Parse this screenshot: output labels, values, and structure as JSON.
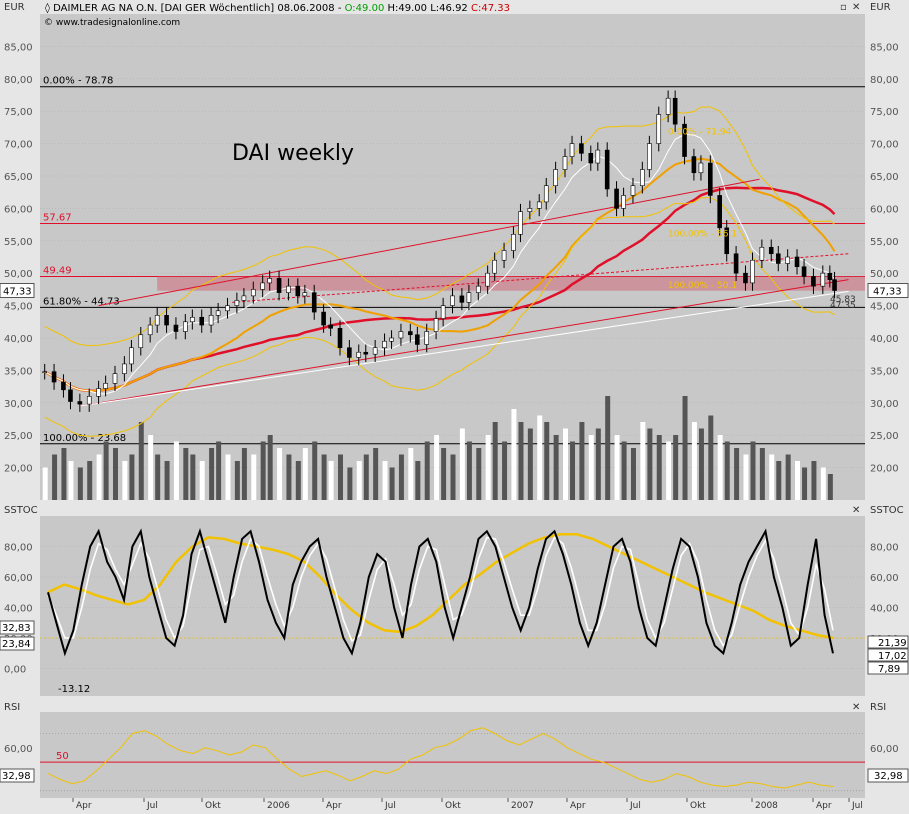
{
  "window": {
    "title": "DAIMLER AG NA O.N. [DAI GER  Wöchentlich] 08.06.2008 - ",
    "ohlc": {
      "o": "O:49.00",
      "h": "H:49.00",
      "l": "L:46.92",
      "c": "C:47.33"
    },
    "source": "www.tradesignalonline.com",
    "annotation": "DAI weekly",
    "colors": {
      "bg": "#c8c8c8",
      "gain": "#00a000",
      "loss": "#cc0000",
      "accent_red": "#e0102a",
      "accent_yellow": "#f2c200",
      "orange": "#f0a000"
    }
  },
  "chart_data": [
    {
      "panel": "price",
      "type": "candlestick",
      "unit_label": "EUR",
      "ylim": [
        15,
        90
      ],
      "y_ticks": [
        "85,00",
        "80,00",
        "75,00",
        "70,00",
        "65,00",
        "60,00",
        "55,00",
        "50,00",
        "45,00",
        "40,00",
        "35,00",
        "30,00",
        "25,00",
        "20,00"
      ],
      "x_ticks": [
        "Apr",
        "Jul",
        "Okt",
        "2006",
        "Apr",
        "Jul",
        "Okt",
        "2007",
        "Apr",
        "Jul",
        "Okt",
        "2008",
        "Apr",
        "Jul"
      ],
      "x_range": [
        2005.08,
        2008.6
      ],
      "last_price_tag": "47,33",
      "price_closes": [
        [
          2005.1,
          34.8
        ],
        [
          2005.14,
          33.2
        ],
        [
          2005.18,
          32.0
        ],
        [
          2005.21,
          30.2
        ],
        [
          2005.25,
          29.8
        ],
        [
          2005.29,
          31.0
        ],
        [
          2005.33,
          32.2
        ],
        [
          2005.36,
          33.0
        ],
        [
          2005.4,
          34.5
        ],
        [
          2005.44,
          36.0
        ],
        [
          2005.47,
          38.5
        ],
        [
          2005.51,
          40.5
        ],
        [
          2005.55,
          42.0
        ],
        [
          2005.58,
          43.5
        ],
        [
          2005.62,
          42.0
        ],
        [
          2005.66,
          41.0
        ],
        [
          2005.7,
          42.5
        ],
        [
          2005.73,
          43.2
        ],
        [
          2005.77,
          42.0
        ],
        [
          2005.81,
          43.5
        ],
        [
          2005.84,
          44.2
        ],
        [
          2005.88,
          45.0
        ],
        [
          2005.92,
          45.8
        ],
        [
          2005.95,
          46.5
        ],
        [
          2005.99,
          47.5
        ],
        [
          2006.03,
          48.5
        ],
        [
          2006.06,
          49.2
        ],
        [
          2006.1,
          47.0
        ],
        [
          2006.14,
          48.0
        ],
        [
          2006.18,
          46.5
        ],
        [
          2006.21,
          47.0
        ],
        [
          2006.25,
          44.0
        ],
        [
          2006.29,
          42.0
        ],
        [
          2006.32,
          41.5
        ],
        [
          2006.36,
          38.5
        ],
        [
          2006.4,
          37.0
        ],
        [
          2006.44,
          37.8
        ],
        [
          2006.47,
          37.5
        ],
        [
          2006.51,
          38.5
        ],
        [
          2006.55,
          39.5
        ],
        [
          2006.58,
          40.0
        ],
        [
          2006.62,
          41.0
        ],
        [
          2006.66,
          40.5
        ],
        [
          2006.69,
          39.0
        ],
        [
          2006.73,
          41.0
        ],
        [
          2006.77,
          43.0
        ],
        [
          2006.8,
          45.0
        ],
        [
          2006.84,
          46.5
        ],
        [
          2006.88,
          45.5
        ],
        [
          2006.91,
          47.0
        ],
        [
          2006.95,
          48.0
        ],
        [
          2006.99,
          50.0
        ],
        [
          2007.02,
          52.0
        ],
        [
          2007.06,
          53.5
        ],
        [
          2007.1,
          56.0
        ],
        [
          2007.13,
          59.5
        ],
        [
          2007.17,
          60.0
        ],
        [
          2007.21,
          61.0
        ],
        [
          2007.24,
          63.5
        ],
        [
          2007.28,
          66.0
        ],
        [
          2007.32,
          68.0
        ],
        [
          2007.35,
          70.0
        ],
        [
          2007.39,
          68.5
        ],
        [
          2007.43,
          67.0
        ],
        [
          2007.46,
          69.0
        ],
        [
          2007.5,
          63.0
        ],
        [
          2007.54,
          60.0
        ],
        [
          2007.57,
          62.0
        ],
        [
          2007.61,
          63.5
        ],
        [
          2007.65,
          66.0
        ],
        [
          2007.68,
          70.0
        ],
        [
          2007.72,
          74.5
        ],
        [
          2007.76,
          77.0
        ],
        [
          2007.79,
          73.0
        ],
        [
          2007.83,
          68.0
        ],
        [
          2007.87,
          65.5
        ],
        [
          2007.9,
          67.0
        ],
        [
          2007.94,
          62.0
        ],
        [
          2007.98,
          57.0
        ],
        [
          2008.01,
          53.0
        ],
        [
          2008.05,
          50.0
        ],
        [
          2008.09,
          48.5
        ],
        [
          2008.12,
          52.0
        ],
        [
          2008.16,
          54.0
        ],
        [
          2008.2,
          53.0
        ],
        [
          2008.23,
          51.5
        ],
        [
          2008.27,
          52.5
        ],
        [
          2008.31,
          51.0
        ],
        [
          2008.34,
          49.5
        ],
        [
          2008.38,
          48.0
        ],
        [
          2008.42,
          50.0
        ],
        [
          2008.45,
          49.0
        ],
        [
          2008.47,
          47.33
        ]
      ],
      "volume": [
        5,
        7,
        8,
        6,
        5,
        6,
        7,
        9,
        8,
        6,
        7,
        12,
        10,
        7,
        6,
        9,
        8,
        7,
        6,
        8,
        9,
        7,
        6,
        8,
        7,
        9,
        10,
        8,
        7,
        6,
        8,
        9,
        7,
        6,
        7,
        5,
        6,
        7,
        8,
        6,
        5,
        7,
        8,
        6,
        9,
        10,
        8,
        7,
        11,
        9,
        8,
        10,
        12,
        9,
        14,
        12,
        11,
        13,
        12,
        10,
        11,
        9,
        12,
        10,
        11,
        16,
        10,
        9,
        8,
        12,
        11,
        10,
        9,
        10,
        16,
        12,
        11,
        13,
        10,
        9,
        8,
        7,
        9,
        8,
        7,
        6,
        7,
        6,
        5,
        6,
        5,
        4
      ],
      "horizontal_levels": [
        {
          "value": 78.78,
          "label": "0.00% - 78.78",
          "color": "#000000"
        },
        {
          "value": 57.67,
          "label": "57.67",
          "color": "#e0102a"
        },
        {
          "value": 49.49,
          "label": "49.49",
          "color": "#e0102a"
        },
        {
          "value": 44.73,
          "label": "61.80% - 44.73",
          "color": "#000000"
        },
        {
          "value": 23.68,
          "label": "100.00% - 23.68",
          "color": "#000000"
        }
      ],
      "inner_fib_labels": [
        {
          "text": "0.00% - 71.94",
          "value": 71.9
        },
        {
          "text": "100.00% - 56.1",
          "value": 56.1
        },
        {
          "text": "100.00% - 50.1",
          "value": 48.2
        }
      ],
      "right_labels": [
        {
          "text": "45,83",
          "value": 46.0
        },
        {
          "text": "47.35",
          "value": 45.1
        }
      ]
    },
    {
      "panel": "stochastic",
      "type": "line",
      "unit_label": "SSTOC",
      "ylim": [
        -18,
        100
      ],
      "y_ticks": [
        "80,00",
        "60,00",
        "40,00",
        "20,00",
        "0,00"
      ],
      "left_tags": [
        "32,83",
        "23,84"
      ],
      "right_tags": [
        "21,39",
        "17,02",
        "7,89"
      ],
      "min_label": "-13.12",
      "fast_k": [
        50,
        30,
        10,
        25,
        55,
        80,
        90,
        70,
        60,
        45,
        80,
        90,
        60,
        40,
        20,
        15,
        35,
        75,
        90,
        70,
        50,
        30,
        60,
        85,
        90,
        70,
        45,
        30,
        20,
        55,
        70,
        80,
        85,
        60,
        40,
        20,
        10,
        30,
        60,
        75,
        70,
        40,
        20,
        55,
        80,
        85,
        70,
        40,
        20,
        40,
        60,
        85,
        90,
        80,
        60,
        40,
        25,
        40,
        65,
        85,
        90,
        75,
        55,
        30,
        15,
        30,
        55,
        80,
        85,
        70,
        40,
        20,
        15,
        40,
        65,
        85,
        80,
        60,
        30,
        15,
        10,
        30,
        55,
        70,
        80,
        90,
        60,
        40,
        15,
        20,
        55,
        85,
        35,
        10
      ],
      "slow_d": [
        48,
        35,
        20,
        20,
        40,
        65,
        82,
        78,
        65,
        55,
        68,
        82,
        72,
        52,
        32,
        20,
        28,
        55,
        78,
        80,
        62,
        42,
        48,
        70,
        85,
        80,
        60,
        42,
        28,
        40,
        60,
        74,
        82,
        72,
        52,
        32,
        18,
        22,
        45,
        65,
        72,
        55,
        35,
        42,
        65,
        80,
        78,
        55,
        32,
        35,
        50,
        72,
        86,
        85,
        70,
        52,
        35,
        35,
        52,
        74,
        86,
        82,
        66,
        45,
        25,
        25,
        42,
        66,
        80,
        78,
        55,
        32,
        20,
        30,
        52,
        74,
        82,
        70,
        45,
        25,
        15,
        22,
        42,
        60,
        74,
        84,
        72,
        52,
        30,
        22,
        40,
        68,
        52,
        25
      ],
      "signal_yellow": [
        50,
        55,
        52,
        48,
        45,
        42,
        45,
        55,
        70,
        80,
        86,
        85,
        82,
        80,
        78,
        75,
        70,
        60,
        48,
        38,
        30,
        25,
        24,
        28,
        35,
        45,
        55,
        62,
        70,
        76,
        82,
        86,
        88,
        88,
        85,
        80,
        75,
        70,
        65,
        60,
        55,
        50,
        46,
        42,
        38,
        32,
        28,
        25,
        22,
        20
      ]
    },
    {
      "panel": "rsi",
      "type": "line",
      "unit_label": "RSI",
      "ylim": [
        25,
        85
      ],
      "y_ticks": [
        "60,00",
        "40,00"
      ],
      "level_label": "50",
      "left_tag": "32,98",
      "right_tag": "32,98",
      "values": [
        42,
        38,
        35,
        37,
        44,
        52,
        60,
        70,
        72,
        68,
        62,
        58,
        56,
        60,
        58,
        55,
        57,
        62,
        60,
        52,
        45,
        40,
        42,
        44,
        41,
        37,
        40,
        44,
        42,
        45,
        52,
        55,
        60,
        62,
        66,
        72,
        74,
        70,
        65,
        62,
        66,
        70,
        66,
        60,
        56,
        52,
        50,
        46,
        42,
        38,
        36,
        38,
        42,
        40,
        36,
        34,
        33,
        34,
        36,
        35,
        33,
        32,
        34,
        36,
        34,
        33
      ]
    }
  ]
}
